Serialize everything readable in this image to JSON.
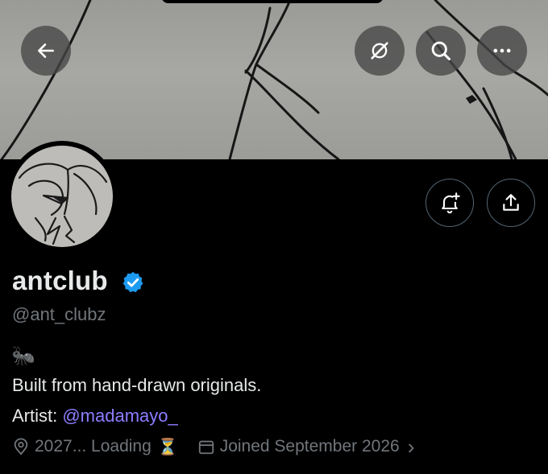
{
  "profile": {
    "display_name": "antclub",
    "handle": "@ant_clubz",
    "bio_emoji": "🐜",
    "bio_line1": "Built from hand-drawn originals.",
    "artist_label": "Artist: ",
    "artist_mention": "@madamayo_"
  },
  "meta": {
    "location": "2027... Loading",
    "location_emoji": "⏳",
    "joined": "Joined September 2026",
    "joined_chevron": "›"
  },
  "icons": {
    "back": "arrow-left-icon",
    "grok": "grok-icon",
    "search": "search-icon",
    "more": "more-icon",
    "notify": "bell-plus-icon",
    "share": "share-icon",
    "verified": "verified-badge-icon",
    "location": "location-pin-icon",
    "calendar": "calendar-icon"
  },
  "colors": {
    "background": "#000000",
    "text_primary": "#e7e9ea",
    "text_secondary": "#71767b",
    "mention": "#8c7dff",
    "verified": "#1d9bf0",
    "button_border": "#536471"
  }
}
